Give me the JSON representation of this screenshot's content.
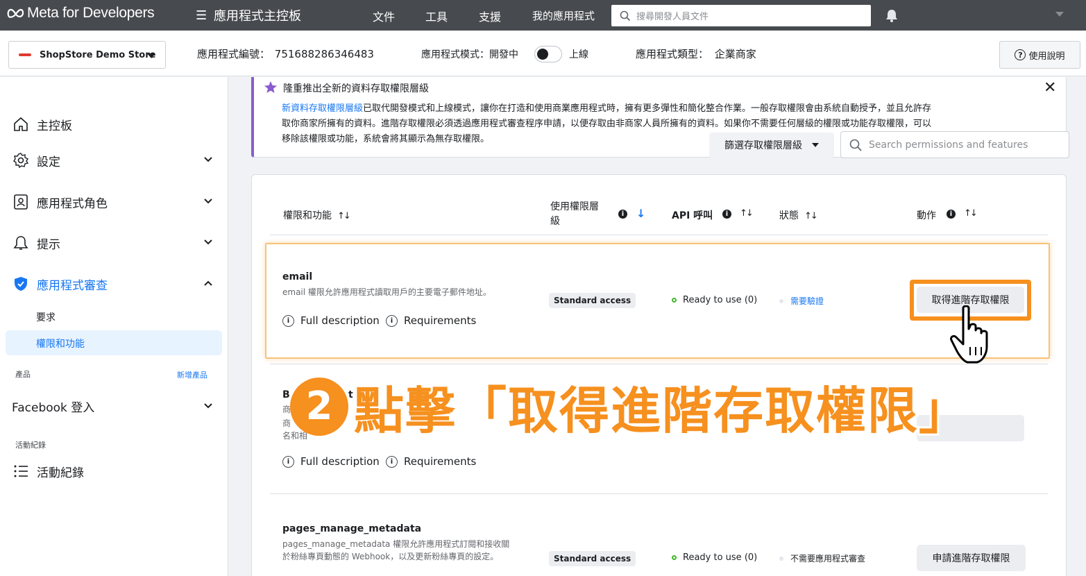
{
  "topbar": {
    "brand": "Meta for Developers",
    "dashboard_title": "應用程式主控板",
    "nav": [
      "文件",
      "工具",
      "支援",
      "我的應用程式"
    ],
    "search_placeholder": "搜尋開發人員文件"
  },
  "subheader": {
    "store_name": "ShopStore Demo Store",
    "app_id_label": "應用程式編號：",
    "app_id": "751688286346483",
    "mode_label": "應用程式模式：開發中",
    "mode_live": "上線",
    "type_label": "應用程式類型：",
    "type_value": "企業商家",
    "help": "使用說明"
  },
  "sidebar": {
    "items": [
      {
        "label": "主控板",
        "icon": "home-icon"
      },
      {
        "label": "設定",
        "icon": "gear-icon"
      },
      {
        "label": "應用程式角色",
        "icon": "id-card-icon"
      },
      {
        "label": "提示",
        "icon": "bell-icon"
      },
      {
        "label": "應用程式審查",
        "icon": "shield-check-icon"
      }
    ],
    "sub_items": [
      "要求",
      "權限和功能"
    ],
    "products_label": "產品",
    "add_product": "新增產品",
    "facebook_login": "Facebook 登入",
    "activity_label": "活動紀錄",
    "activity_item": "活動紀錄"
  },
  "banner": {
    "title": "隆重推出全新的資料存取權限層級",
    "link_text": "新資料存取權限層級",
    "line1_rest": "已取代開發模式和上線模式，讓你在打造和使用商業應用程式時，擁有更多彈性和簡化整合作業。一般存取權限會由系統自動授予，並且允許存",
    "line2": "取你商家所擁有的資料。進階存取權限必須透過應用程式審查程序申請，以便存取由非商家人員所擁有的資料。如果你不需要任何層級的權限或功能存取權限，可以",
    "line3": "移除該權限或功能，系統會將其顯示為無存取權限。",
    "filter": "篩選存取權限層級",
    "search_placeholder": "Search permissions and features"
  },
  "table": {
    "headers": {
      "name": "權限和功能",
      "access_line1": "使用權限層",
      "access_line2": "級",
      "api": "API 呼叫",
      "status": "狀態",
      "action": "動作"
    },
    "rows": [
      {
        "name": "email",
        "desc": "email 權限允許應用程式讀取用戶的主要電子郵件地址。",
        "full_description": "Full description",
        "requirements": "Requirements",
        "access": "Standard access",
        "api_status": "Ready to use (0)",
        "review": "需要驗證",
        "action": "取得進階存取權限"
      },
      {
        "name_visible_1": "B",
        "name_visible_2": "t Us",
        "desc_partial_1": "商",
        "desc_partial_2": "商",
        "desc_partial_3": "名和相",
        "full_description": "Full description",
        "requirements": "Requirements"
      },
      {
        "name": "pages_manage_metadata",
        "desc_line1": "pages_manage_metadata 權限允許應用程式訂閱和接收關",
        "desc_line2": "於粉絲專頁動態的 Webhook，以及更新粉絲專頁的設定。",
        "access": "Standard access",
        "api_status": "Ready to use (0)",
        "review": "不需要應用程式審查",
        "action": "申請進階存取權限"
      }
    ]
  },
  "annotation": {
    "step": "2",
    "text": "點擊「取得進階存取權限」"
  },
  "colors": {
    "accent": "#1877f2",
    "annotation": "#f6901e",
    "topbar": "#474a4e"
  }
}
